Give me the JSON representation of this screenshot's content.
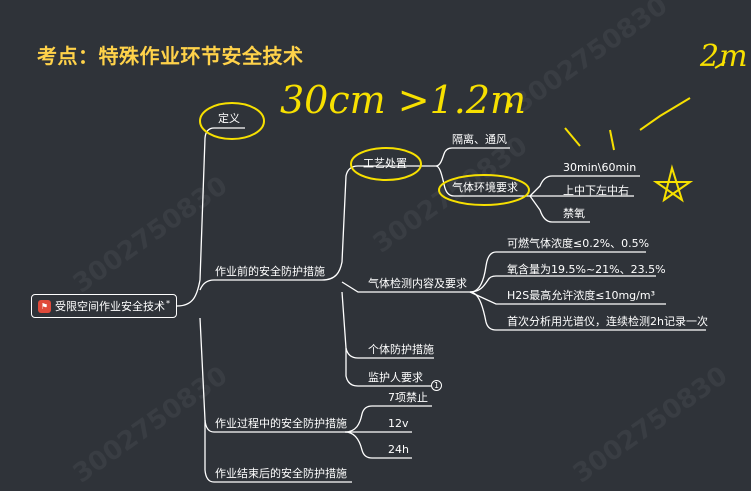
{
  "title": "考点：特殊作业环节安全技术",
  "root": {
    "label": "受限空间作业安全技术",
    "marker": "*"
  },
  "level1": {
    "definition": "定义",
    "before": "作业前的安全防护措施",
    "during": "作业过程中的安全防护措施",
    "after": "作业结束后的安全防护措施"
  },
  "before_children": {
    "process": "工艺处置",
    "gas_detection": "气体检测内容及要求",
    "personal": "个体防护措施",
    "guardian": "监护人要求"
  },
  "process_children": {
    "isolation": "隔离、通风",
    "gas_env": "气体环境要求"
  },
  "gas_env_children": [
    "30min\\60min",
    "上中下左中右",
    "禁氧"
  ],
  "gas_detection_children": [
    "可燃气体浓度≤0.2%、0.5%",
    "氧含量为19.5%~21%、23.5%",
    "H2S最高允许浓度≤10mg/m³",
    "首次分析用光谱仪，连续检测2h记录一次"
  ],
  "during_children": [
    "7项禁止",
    "12v",
    "24h"
  ],
  "guardian_badge": "1",
  "handwriting": {
    "note_main": "30cm >1.2m",
    "note_corner": "2m"
  },
  "watermark": "3002750830",
  "colors": {
    "background": "#2f3339",
    "title": "#ffd24a",
    "lines": "#ffffff",
    "highlight": "#f7e000",
    "flag": "#e04a3a"
  }
}
